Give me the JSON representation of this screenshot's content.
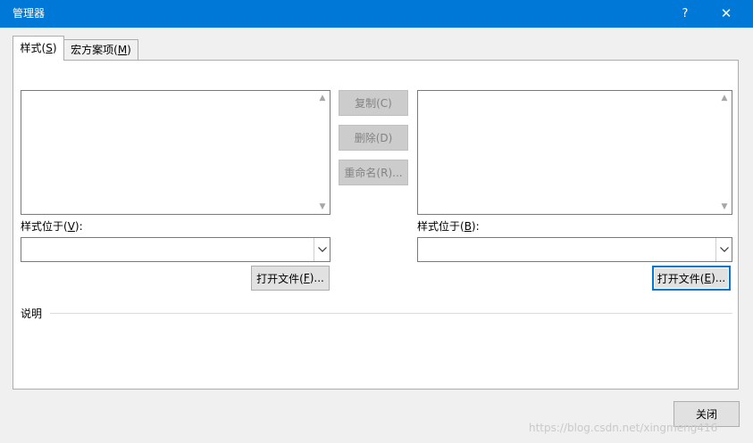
{
  "window": {
    "title": "管理器",
    "help_label": "?",
    "close_label": "✕"
  },
  "tabs": [
    {
      "label_pre": "样式(",
      "mnemonic": "S",
      "label_post": ")"
    },
    {
      "label_pre": "宏方案项(",
      "mnemonic": "M",
      "label_post": ")"
    }
  ],
  "middle_buttons": {
    "copy": "复制(C)",
    "delete": "删除(D)",
    "rename": "重命名(R)..."
  },
  "left": {
    "label_pre": "样式位于(",
    "mnemonic": "V",
    "label_post": "):",
    "combo_value": "",
    "open_pre": "打开文件(",
    "open_mnemonic": "F",
    "open_post": ")..."
  },
  "right": {
    "label_pre": "样式位于(",
    "mnemonic": "B",
    "label_post": "):",
    "combo_value": "",
    "open_pre": "打开文件(",
    "open_mnemonic": "E",
    "open_post": ")..."
  },
  "description": {
    "label": "说明",
    "text": ""
  },
  "footer": {
    "close_label": "关闭"
  },
  "watermark": "https://blog.csdn.net/xingmeng416",
  "icons": {
    "scroll_up": "▲",
    "scroll_down": "▼",
    "dropdown": "∨"
  },
  "colors": {
    "titlebar": "#0078d7",
    "focus": "#0078d7"
  }
}
